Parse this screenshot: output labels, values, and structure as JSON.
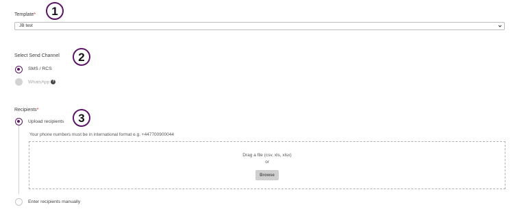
{
  "template": {
    "label": "Template",
    "required_mark": "*",
    "selected": "JB test"
  },
  "channel": {
    "label": "Select Send Channel",
    "options": [
      {
        "label": "SMS / RCS",
        "state": "selected"
      },
      {
        "label": "WhatsApp",
        "state": "disabled"
      }
    ]
  },
  "recipients": {
    "label": "Recipients",
    "required_mark": "*",
    "upload_option": "Upload recipients",
    "hint": "Your phone numbers must be in international format e.g. +447700900044",
    "dropzone": {
      "text": "Drag a file (csv, xls, xlsx)",
      "or": "or",
      "button": "Browse"
    },
    "manual_option": "Enter recipients manually"
  },
  "markers": [
    "1",
    "2",
    "3"
  ],
  "colors": {
    "accent": "#5a1466",
    "required": "#d9232e",
    "disabled": "#d3d3d3"
  }
}
